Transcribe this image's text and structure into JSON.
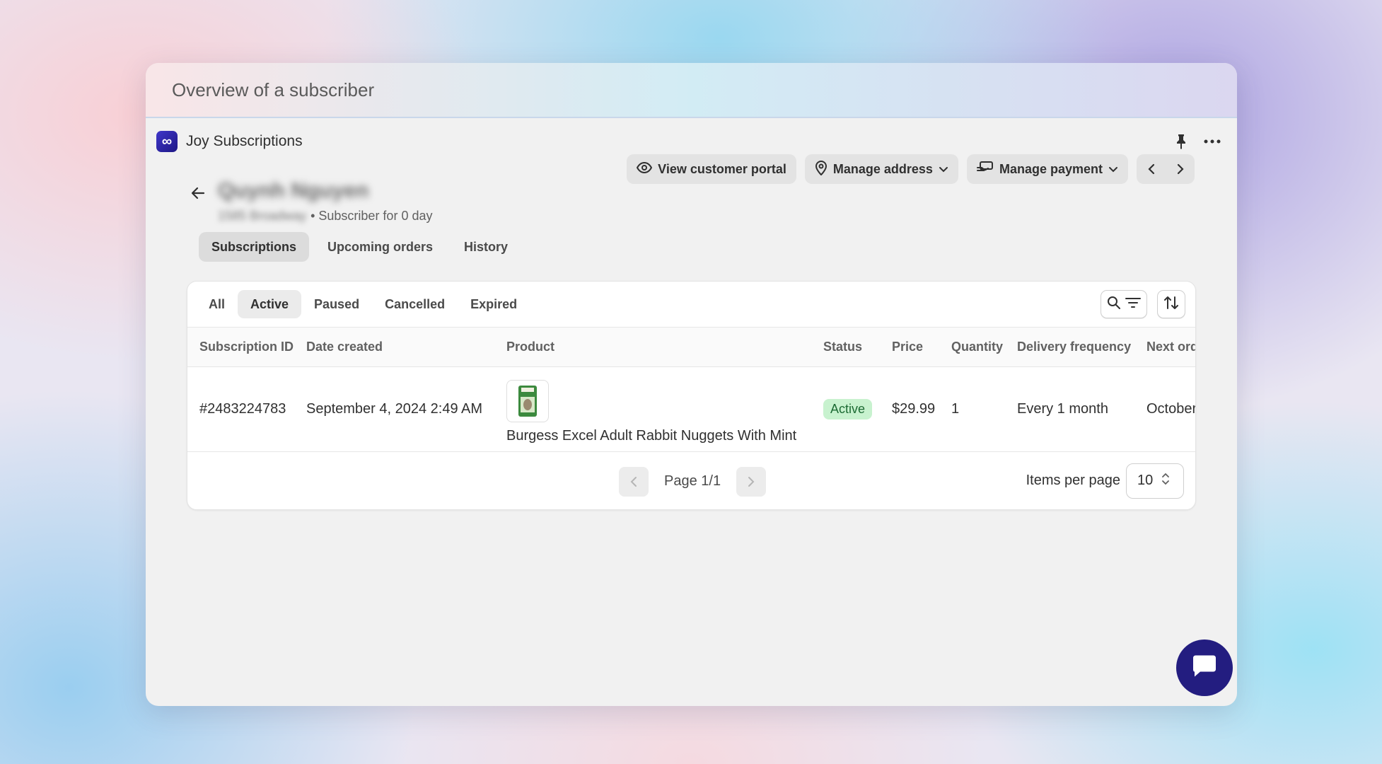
{
  "window": {
    "title": "Overview of a subscriber"
  },
  "app": {
    "name": "Joy Subscriptions",
    "logo_glyph": "∞"
  },
  "subscriber": {
    "name": "Quynh Nguyen",
    "address": "1585 Broadway",
    "since": "• Subscriber for 0 day"
  },
  "actions": {
    "view_portal": "View customer portal",
    "manage_address": "Manage address",
    "manage_payment": "Manage payment"
  },
  "tabs": [
    {
      "label": "Subscriptions"
    },
    {
      "label": "Upcoming orders"
    },
    {
      "label": "History"
    }
  ],
  "filters": [
    {
      "label": "All"
    },
    {
      "label": "Active"
    },
    {
      "label": "Paused"
    },
    {
      "label": "Cancelled"
    },
    {
      "label": "Expired"
    }
  ],
  "table": {
    "columns": [
      "Subscription ID",
      "Date created",
      "Product",
      "Status",
      "Price",
      "Quantity",
      "Delivery frequency",
      "Next order"
    ],
    "rows": [
      {
        "id": "#2483224783",
        "date": "September 4, 2024 2:49 AM",
        "product": "Burgess Excel Adult Rabbit Nuggets With Mint",
        "status": "Active",
        "price": "$29.99",
        "quantity": "1",
        "frequency": "Every 1 month",
        "next": "October"
      }
    ]
  },
  "pagination": {
    "page_text": "Page 1/1",
    "items_per_page_label": "Items per page",
    "items_per_page_value": "10"
  },
  "colors": {
    "logo": "#2f27b0",
    "chat": "#231d80",
    "status_active_bg": "#c8f2cf",
    "status_active_text": "#1d6b34"
  }
}
